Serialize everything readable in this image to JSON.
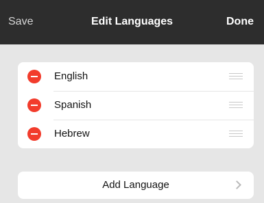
{
  "navbar": {
    "left_label": "Save",
    "title": "Edit Languages",
    "right_label": "Done"
  },
  "languages": [
    {
      "label": "English"
    },
    {
      "label": "Spanish"
    },
    {
      "label": "Hebrew"
    }
  ],
  "add_language": {
    "label": "Add Language"
  },
  "icons": {
    "delete": "minus-circle-icon",
    "reorder": "drag-handle-icon",
    "disclosure": "chevron-right-icon"
  },
  "colors": {
    "navbar_bg": "#2d2d2d",
    "background": "#e6e6e6",
    "delete_red": "#f23c2c"
  }
}
